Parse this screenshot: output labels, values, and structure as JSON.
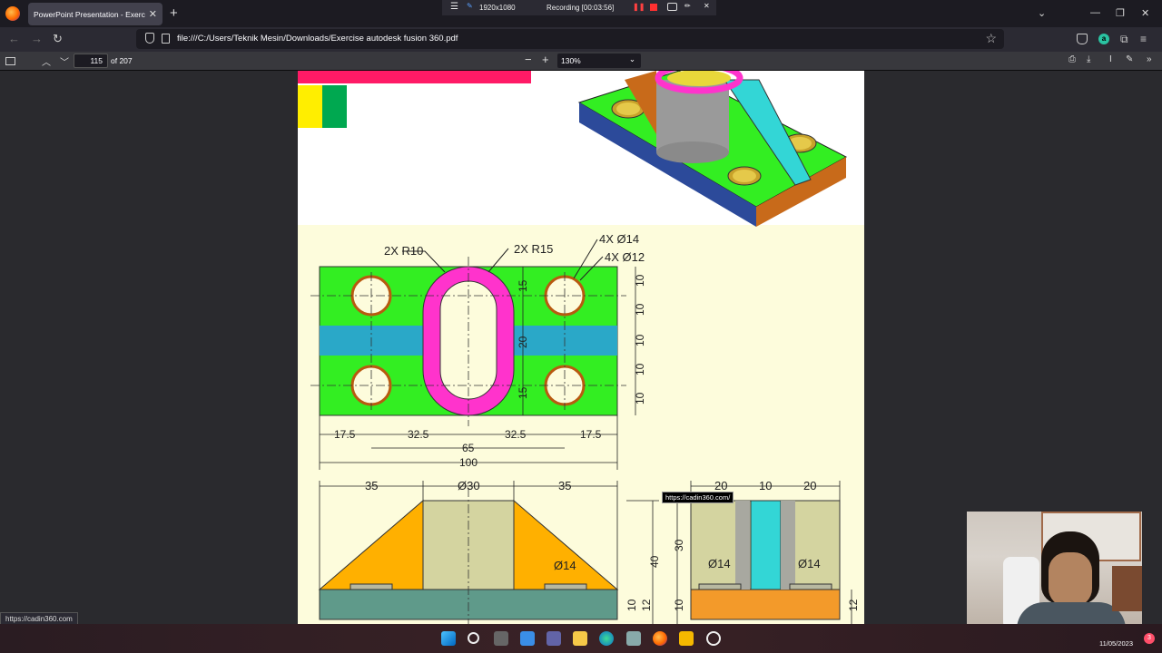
{
  "browser": {
    "tab_title": "PowerPoint Presentation - Exercise",
    "tab_close": "✕",
    "new_tab": "+",
    "url": "file:///C:/Users/Teknik Mesin/Downloads/Exercise autodesk fusion 360.pdf",
    "ext_badge": "a"
  },
  "recorder": {
    "resolution": "1920x1080",
    "status": "Recording [00:03:56]"
  },
  "pdf_toolbar": {
    "page_number": "115",
    "page_total": "of 207",
    "zoom": "130%"
  },
  "drawing": {
    "top_view": {
      "callouts": [
        "2X R10",
        "2X R15",
        "4X Ø14",
        "4X Ø12"
      ],
      "vertical_dims": [
        "15",
        "20",
        "15"
      ],
      "right_dims": [
        "10",
        "10",
        "10",
        "10",
        "10"
      ],
      "bottom_dims": [
        "17.5",
        "32.5",
        "32.5",
        "17.5"
      ],
      "dim_65": "65",
      "dim_100": "100"
    },
    "front_view": {
      "top_dims": [
        "35",
        "Ø30",
        "35"
      ],
      "hole": "Ø14",
      "dim_40": "40",
      "dim_10": "10",
      "dim_12": "12"
    },
    "side_view": {
      "top_dims": [
        "20",
        "10",
        "20"
      ],
      "dim_30": "30",
      "dim_10": "10",
      "holes": [
        "Ø14",
        "Ø14"
      ],
      "dim_12": "12"
    }
  },
  "status_url": "https://cadin360.com",
  "tooltip": "https://cadin360.com/",
  "taskbar": {
    "date": "11/05/2023",
    "notif": "3"
  },
  "colors": {
    "green": "#33ee22",
    "magenta": "#ff33cc",
    "blue": "#2aa8c8",
    "orange": "#ffb000",
    "teal": "#5f9a8a",
    "cream": "#fdfcdc",
    "dark_orange": "#f39a2a",
    "cyan": "#33d6d6"
  }
}
